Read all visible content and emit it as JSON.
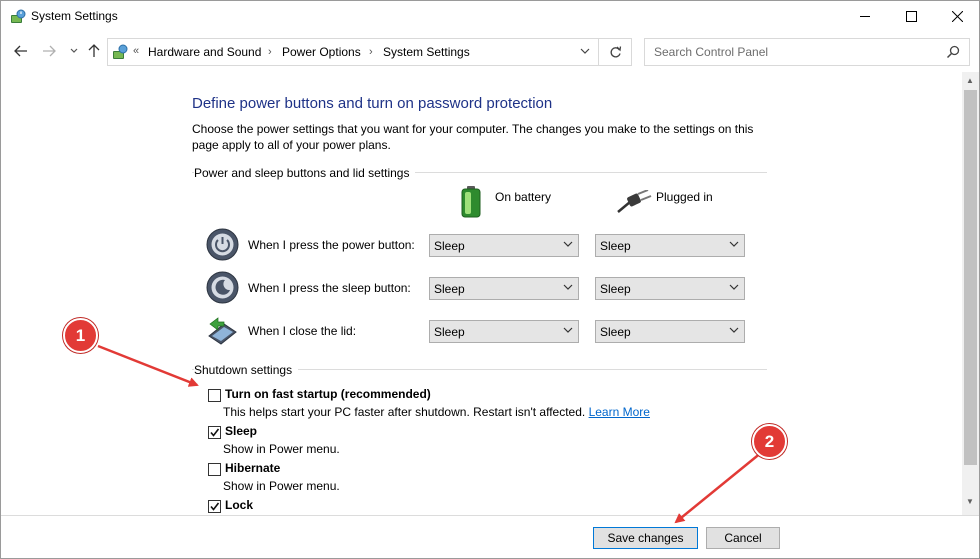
{
  "window": {
    "title": "System Settings",
    "title_icon": "power-options-icon"
  },
  "address_bar": {
    "overflow": "«",
    "crumbs": [
      "Hardware and Sound",
      "Power Options",
      "System Settings"
    ],
    "search_placeholder": "Search Control Panel"
  },
  "page": {
    "heading": "Define power buttons and turn on password protection",
    "description": "Choose the power settings that you want for your computer. The changes you make to the settings on this page apply to all of your power plans."
  },
  "buttons_section": {
    "group_label": "Power and sleep buttons and lid settings",
    "columns": [
      {
        "label": "On battery",
        "icon": "battery-icon"
      },
      {
        "label": "Plugged in",
        "icon": "power-plug-icon"
      }
    ],
    "rows": [
      {
        "label": "When I press the power button:",
        "icon": "power-button-icon",
        "on_battery": "Sleep",
        "plugged_in": "Sleep"
      },
      {
        "label": "When I press the sleep button:",
        "icon": "sleep-button-icon",
        "on_battery": "Sleep",
        "plugged_in": "Sleep"
      },
      {
        "label": "When I close the lid:",
        "icon": "laptop-lid-icon",
        "on_battery": "Sleep",
        "plugged_in": "Sleep"
      }
    ]
  },
  "shutdown_section": {
    "group_label": "Shutdown settings",
    "items": [
      {
        "label": "Turn on fast startup (recommended)",
        "checked": false,
        "sub": "This helps start your PC faster after shutdown. Restart isn't affected.",
        "link": "Learn More"
      },
      {
        "label": "Sleep",
        "checked": true,
        "sub": "Show in Power menu."
      },
      {
        "label": "Hibernate",
        "checked": false,
        "sub": "Show in Power menu."
      },
      {
        "label": "Lock",
        "checked": true
      }
    ]
  },
  "footer": {
    "save_label": "Save changes",
    "cancel_label": "Cancel"
  },
  "annotations": {
    "badge_1": "1",
    "badge_2": "2",
    "color": "#e23a36"
  }
}
